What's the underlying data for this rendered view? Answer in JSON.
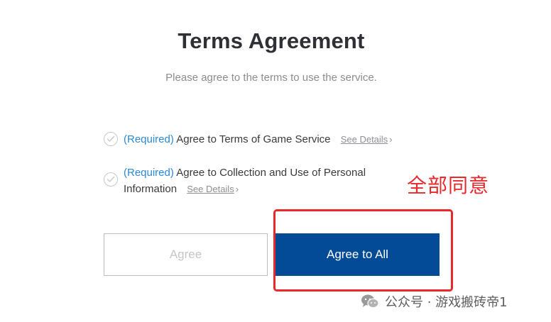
{
  "header": {
    "title": "Terms Agreement",
    "subtitle": "Please agree to the terms to use the service."
  },
  "terms": [
    {
      "required": "(Required)",
      "text": "Agree to Terms of Game Service",
      "details": "See Details"
    },
    {
      "required": "(Required)",
      "text": "Agree to Collection and Use of Personal Information",
      "details": "See Details"
    }
  ],
  "buttons": {
    "agree": "Agree",
    "agree_all": "Agree to All"
  },
  "annotation": {
    "text": "全部同意",
    "color": "#e8282b"
  },
  "watermark": {
    "text": "公众号 · 游戏搬砖帝1"
  },
  "colors": {
    "primary": "#034b96",
    "required": "#2a89d8",
    "annotation": "#e8282b"
  }
}
